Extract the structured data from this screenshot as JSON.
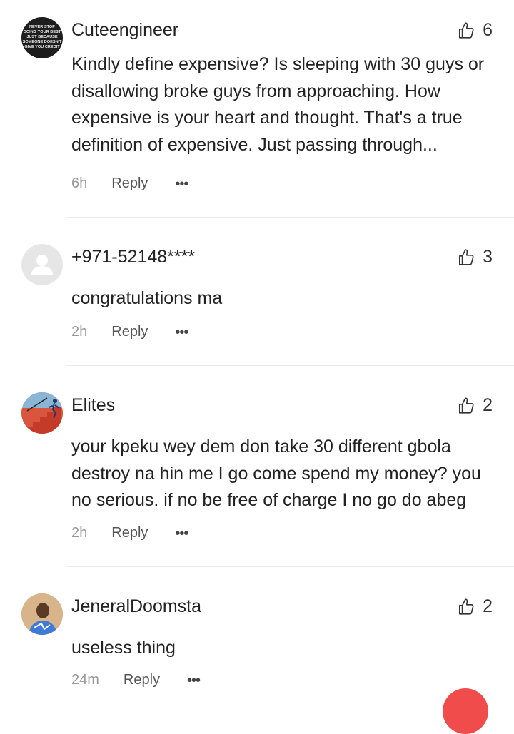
{
  "comments": [
    {
      "username": "Cuteengineer",
      "likes": "6",
      "text": "Kindly define expensive? Is sleeping with 30 guys or disallowing broke guys from approaching. How expensive is your heart and thought. That's a true definition of expensive. Just passing through...",
      "time": "6h",
      "reply": "Reply",
      "more": "•••",
      "avatar_text": [
        "NEVER STOP",
        "DOING YOUR BEST",
        "JUST BECAUSE",
        "SOMEONE DOESN'T",
        "GIVE YOU CREDIT"
      ]
    },
    {
      "username": "+971-52148****",
      "likes": "3",
      "text": "congratulations ma",
      "time": "2h",
      "reply": "Reply",
      "more": "•••"
    },
    {
      "username": "Elites",
      "likes": "2",
      "text": "your kpeku wey dem don take 30 different gbola destroy na hin me I go come spend my money? you no serious. if no be free of charge I no go do abeg",
      "time": "2h",
      "reply": "Reply",
      "more": "•••"
    },
    {
      "username": "JeneralDoomsta",
      "likes": "2",
      "text": "useless thing",
      "time": "24m",
      "reply": "Reply",
      "more": "•••"
    }
  ],
  "colors": {
    "accent_fab": "#f14c4c",
    "divider": "#ececec",
    "meta": "#999999"
  },
  "icons": {
    "like": "thumbs-up-icon",
    "more": "more-dots-icon"
  }
}
